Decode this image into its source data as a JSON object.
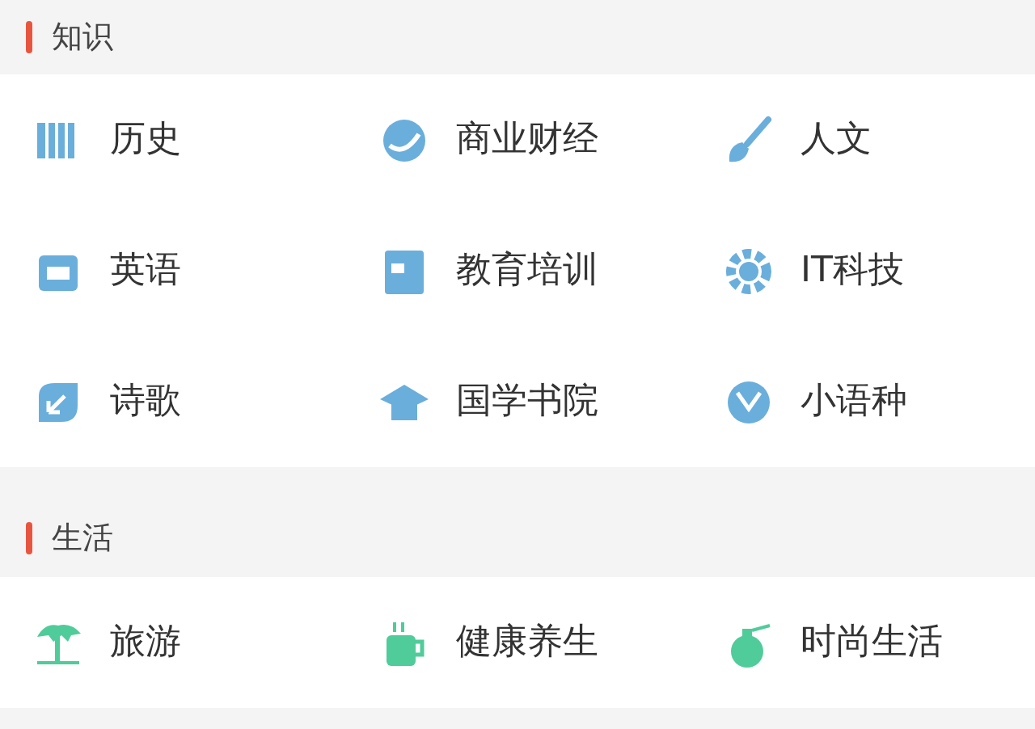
{
  "sections": [
    {
      "title": "知识",
      "color": "#6aaedc",
      "items": [
        {
          "label": "历史",
          "kind": "books"
        },
        {
          "label": "商业财经",
          "kind": "globe"
        },
        {
          "label": "人文",
          "kind": "brush"
        },
        {
          "label": "英语",
          "kind": "card"
        },
        {
          "label": "教育培训",
          "kind": "notebook"
        },
        {
          "label": "IT科技",
          "kind": "gear"
        },
        {
          "label": "诗歌",
          "kind": "leaf"
        },
        {
          "label": "国学书院",
          "kind": "cap"
        },
        {
          "label": "小语种",
          "kind": "ball"
        }
      ]
    },
    {
      "title": "生活",
      "color": "#4fcc9a",
      "items": [
        {
          "label": "旅游",
          "kind": "tree"
        },
        {
          "label": "健康养生",
          "kind": "mug"
        },
        {
          "label": "时尚生活",
          "kind": "bottle"
        }
      ]
    }
  ]
}
